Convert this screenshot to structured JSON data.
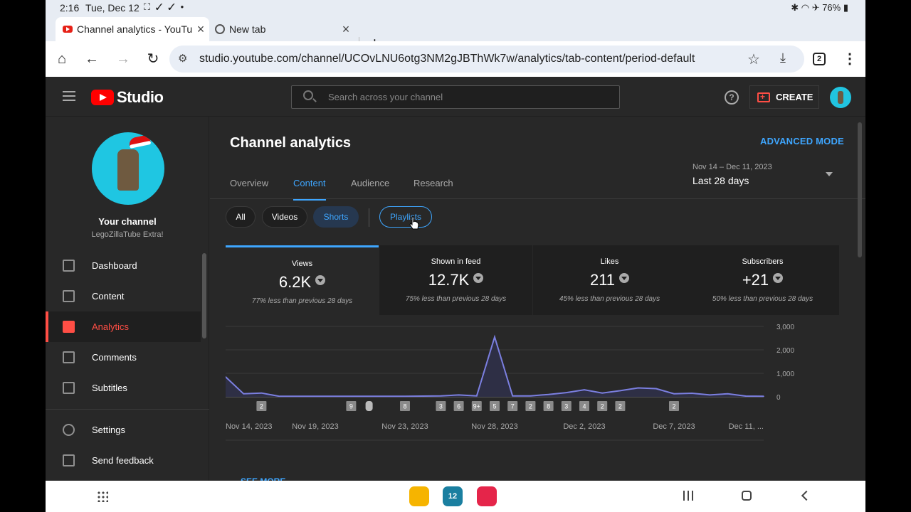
{
  "status_bar": {
    "time": "2:16",
    "date": "Tue, Dec 12",
    "battery": "76%"
  },
  "browser": {
    "tabs": [
      {
        "title": "Channel analytics - YouTube Studio",
        "active": true
      },
      {
        "title": "New tab",
        "active": false
      }
    ],
    "url": "studio.youtube.com/channel/UCOvLNU6otg3NM2gJBThWk7w/analytics/tab-content/period-default",
    "tab_count": "2"
  },
  "header": {
    "logo_text": "Studio",
    "search_placeholder": "Search across your channel",
    "create_label": "CREATE"
  },
  "sidebar": {
    "your_channel": "Your channel",
    "channel_name": "LegoZillaTube Extra!",
    "items": [
      {
        "label": "Dashboard",
        "icon": "dashboard-icon",
        "active": false
      },
      {
        "label": "Content",
        "icon": "content-icon",
        "active": false
      },
      {
        "label": "Analytics",
        "icon": "analytics-icon",
        "active": true
      },
      {
        "label": "Comments",
        "icon": "comments-icon",
        "active": false
      },
      {
        "label": "Subtitles",
        "icon": "subtitles-icon",
        "active": false
      },
      {
        "label": "Settings",
        "icon": "gear-icon",
        "active": false
      },
      {
        "label": "Send feedback",
        "icon": "feedback-icon",
        "active": false
      }
    ]
  },
  "main": {
    "title": "Channel analytics",
    "advanced_mode": "ADVANCED MODE",
    "tabs": [
      "Overview",
      "Content",
      "Audience",
      "Research"
    ],
    "active_tab": "Content",
    "date_range": "Nov 14 – Dec 11, 2023",
    "date_label": "Last 28 days",
    "chips": [
      "All",
      "Videos",
      "Shorts",
      "Playlists"
    ],
    "selected_chip": "Shorts",
    "see_more": "SEE MORE"
  },
  "metrics": [
    {
      "label": "Views",
      "value": "6.2K",
      "comparison": "77% less than previous 28 days"
    },
    {
      "label": "Shown in feed",
      "value": "12.7K",
      "comparison": "75% less than previous 28 days"
    },
    {
      "label": "Likes",
      "value": "211",
      "comparison": "45% less than previous 28 days"
    },
    {
      "label": "Subscribers",
      "value": "+21",
      "comparison": "50% less than previous 28 days"
    }
  ],
  "colors": {
    "accent": "#3ea6ff",
    "brand_red": "#ff0000",
    "active_nav": "#ff4e45",
    "line": "#7b7fe0"
  },
  "chart_data": {
    "type": "line",
    "series": [
      {
        "values": [
          850,
          130,
          160,
          20,
          20,
          20,
          20,
          20,
          20,
          20,
          20,
          30,
          40,
          80,
          40,
          2550,
          40,
          40,
          100,
          180,
          300,
          160,
          260,
          380,
          350,
          130,
          150,
          80,
          130,
          30,
          20
        ]
      }
    ],
    "x_labels": [
      "Nov 14, 2023",
      "Nov 19, 2023",
      "Nov 23, 2023",
      "Nov 28, 2023",
      "Dec 2, 2023",
      "Dec 7, 2023",
      "Dec 11, ..."
    ],
    "y_ticks": [
      "3,000",
      "2,000",
      "1,000",
      "0"
    ],
    "ylim": [
      0,
      3000
    ],
    "markers": [
      {
        "x": 2,
        "label": "2"
      },
      {
        "x": 7,
        "label": "9"
      },
      {
        "x": 8,
        "label": "shorts-icon"
      },
      {
        "x": 10,
        "label": "8"
      },
      {
        "x": 12,
        "label": "3"
      },
      {
        "x": 13,
        "label": "6"
      },
      {
        "x": 14,
        "label": "9+"
      },
      {
        "x": 15,
        "label": "5"
      },
      {
        "x": 16,
        "label": "7"
      },
      {
        "x": 17,
        "label": "2"
      },
      {
        "x": 18,
        "label": "8"
      },
      {
        "x": 19,
        "label": "3"
      },
      {
        "x": 20,
        "label": "4"
      },
      {
        "x": 21,
        "label": "2"
      },
      {
        "x": 22,
        "label": "2"
      },
      {
        "x": 25,
        "label": "2"
      }
    ]
  }
}
